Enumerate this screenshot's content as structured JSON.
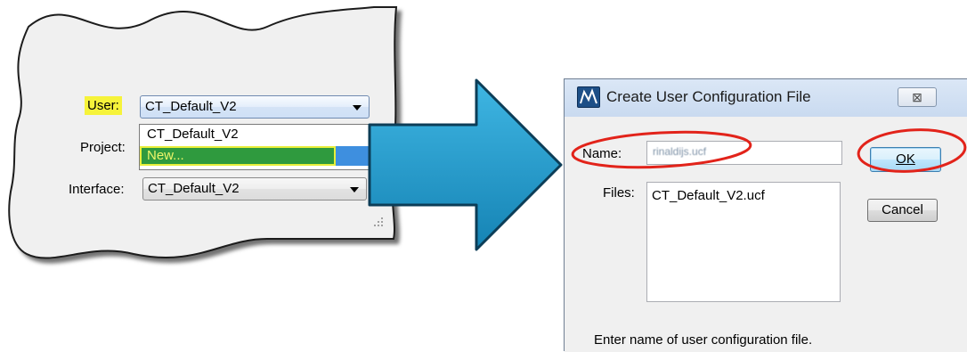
{
  "left_panel": {
    "user_label": "User:",
    "project_label": "Project:",
    "interface_label": "Interface:",
    "user_combo_value": "CT_Default_V2",
    "interface_combo_value": "CT_Default_V2",
    "dropdown_items": [
      "CT_Default_V2",
      "New..."
    ]
  },
  "dialog": {
    "title": "Create User Configuration File",
    "close_glyph": "⊠",
    "name_label": "Name:",
    "name_value": "rinaldijs.ucf",
    "files_label": "Files:",
    "files": [
      "CT_Default_V2.ucf"
    ],
    "ok_label": "OK",
    "cancel_label": "Cancel",
    "status_text": "Enter name of user configuration file."
  },
  "colors": {
    "highlight_yellow": "#f6f33a",
    "selection_green": "#2f9a3e",
    "selection_blue": "#3e8fdf",
    "arrow_teal": "#1e9bc9",
    "annotation_red": "#e2231a"
  },
  "icons": {
    "app_icon": "microstation-icon",
    "resize_grip": "resize-grip-icon",
    "combo_arrow": "chevron-down-icon"
  }
}
